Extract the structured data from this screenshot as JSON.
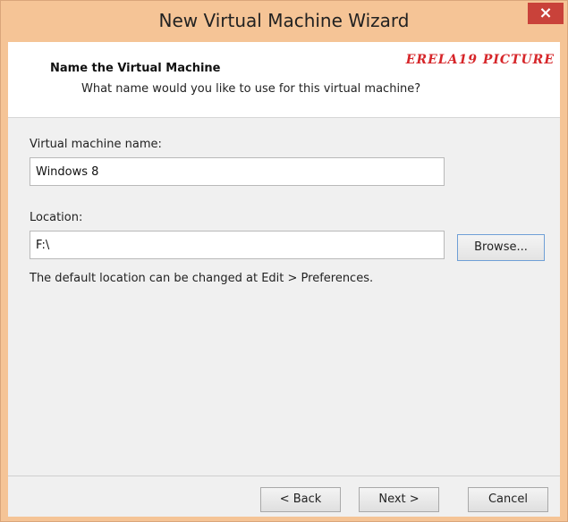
{
  "window": {
    "title": "New Virtual Machine Wizard",
    "close_glyph": "×"
  },
  "header": {
    "title": "Name the Virtual Machine",
    "subtitle": "What name would you like to use for this virtual machine?",
    "watermark": "ERELA19 PICTURE"
  },
  "form": {
    "vm_name_label": "Virtual machine name:",
    "vm_name_value": "Windows 8",
    "location_label": "Location:",
    "location_value": "F:\\",
    "browse_label": "Browse...",
    "hint": "The default location can be changed at Edit > Preferences."
  },
  "footer": {
    "back_label": "< Back",
    "next_label": "Next >",
    "cancel_label": "Cancel"
  },
  "colors": {
    "titlebar": "#f5c496",
    "close_button": "#c9423a",
    "watermark": "#d6262a"
  }
}
